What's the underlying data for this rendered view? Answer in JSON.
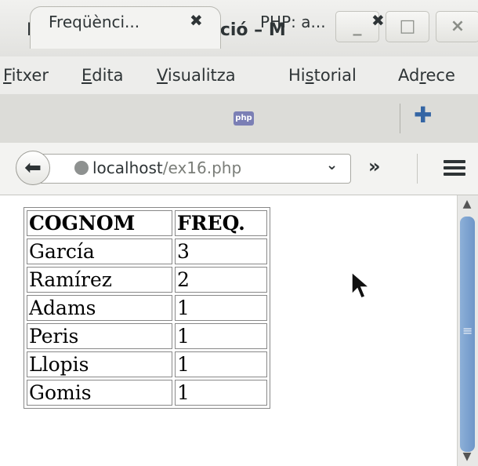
{
  "window": {
    "title": "Freqüència i ordenació – M",
    "minimize_label": "_",
    "maximize_label": "□",
    "close_label": "×"
  },
  "menu": [
    {
      "accel": "F",
      "rest": "itxer"
    },
    {
      "accel": "E",
      "rest": "dita"
    },
    {
      "accel": "V",
      "rest": "isualitza"
    },
    {
      "pre": "Hi",
      "accel": "s",
      "rest": "torial"
    },
    {
      "pre": "Ad",
      "accel": "r",
      "rest": "ece"
    }
  ],
  "tabs": [
    {
      "label": "Freqüènci...",
      "close": "✖",
      "active": true
    },
    {
      "label": "PHP: a...",
      "close": "✖",
      "active": false,
      "icon": "php-icon",
      "icon_text": "php"
    }
  ],
  "new_tab_label": "✚",
  "nav": {
    "back_glyph": "⬅",
    "url_host": "localhost",
    "url_path": "/ex16.php",
    "dropdown_glyph": "⌄",
    "overflow_glyph": "»"
  },
  "table": {
    "headers": [
      "COGNOM",
      "FREQ."
    ],
    "rows": [
      [
        "García",
        "3"
      ],
      [
        "Ramírez",
        "2"
      ],
      [
        "Adams",
        "1"
      ],
      [
        "Peris",
        "1"
      ],
      [
        "Llopis",
        "1"
      ],
      [
        "Gomis",
        "1"
      ]
    ]
  },
  "scrollbar": {
    "up": "▲",
    "down": "▼",
    "grip": "≡"
  }
}
